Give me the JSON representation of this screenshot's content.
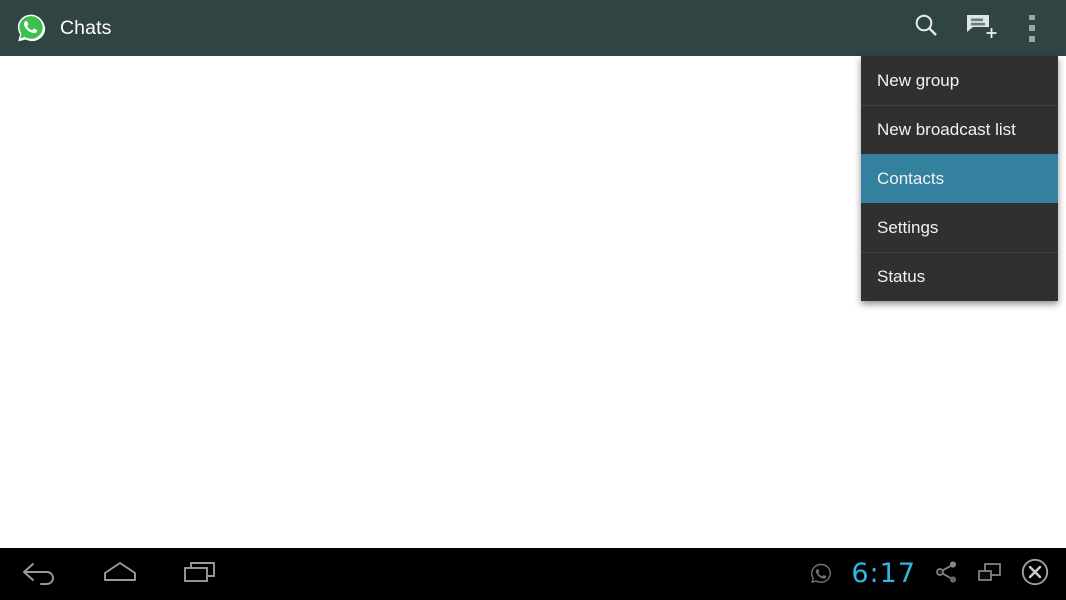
{
  "appbar": {
    "title": "Chats",
    "logo_icon": "whatsapp-logo",
    "actions": [
      {
        "name": "search",
        "label": "Search",
        "icon": "search-icon"
      },
      {
        "name": "new-chat",
        "label": "New chat",
        "icon": "new-chat-icon"
      },
      {
        "name": "overflow",
        "label": "More options",
        "icon": "overflow-menu-icon"
      }
    ],
    "background_color": "#2f4443",
    "title_color": "#ffffff"
  },
  "overflow_menu": {
    "background_color": "#303030",
    "highlight_color": "#33809f",
    "items": [
      {
        "label": "New group",
        "selected": false
      },
      {
        "label": "New broadcast list",
        "selected": false
      },
      {
        "label": "Contacts",
        "selected": true
      },
      {
        "label": "Settings",
        "selected": false
      },
      {
        "label": "Status",
        "selected": false
      }
    ]
  },
  "content": {
    "background_color": "#ffffff",
    "empty": true
  },
  "navbar": {
    "background_color": "#000000",
    "buttons": [
      {
        "name": "back",
        "label": "Back",
        "icon": "back-arrow-icon"
      },
      {
        "name": "home",
        "label": "Home",
        "icon": "home-icon"
      },
      {
        "name": "recents",
        "label": "Recent apps",
        "icon": "recent-apps-icon"
      }
    ],
    "status": {
      "notification_icon": "whatsapp-notification-icon",
      "time": "6:17",
      "time_color": "#33b5e5",
      "icons": [
        {
          "name": "share",
          "label": "Share",
          "icon": "share-icon"
        },
        {
          "name": "screenshot",
          "label": "Screenshot",
          "icon": "windows-icon"
        },
        {
          "name": "close",
          "label": "Close",
          "icon": "close-circle-icon"
        }
      ]
    }
  }
}
